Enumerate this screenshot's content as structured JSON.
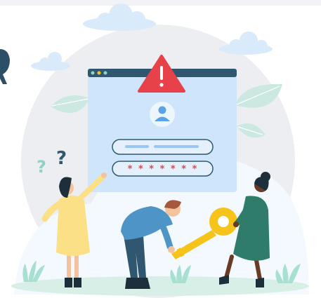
{
  "login_form": {
    "password_mask": "* * * * * * *"
  },
  "icons": [
    "warning-icon",
    "user-avatar-icon",
    "question-mark-icon",
    "key-icon",
    "cloud-icon",
    "leaf-icon"
  ],
  "colors": {
    "window_fill": "#cfe5fb",
    "window_titlebar": "#2f5870",
    "warning_red": "#e7414a",
    "key_yellow": "#f5c31a",
    "leaf_green": "#cbe9e0",
    "background_circle": "#eef0f3"
  }
}
